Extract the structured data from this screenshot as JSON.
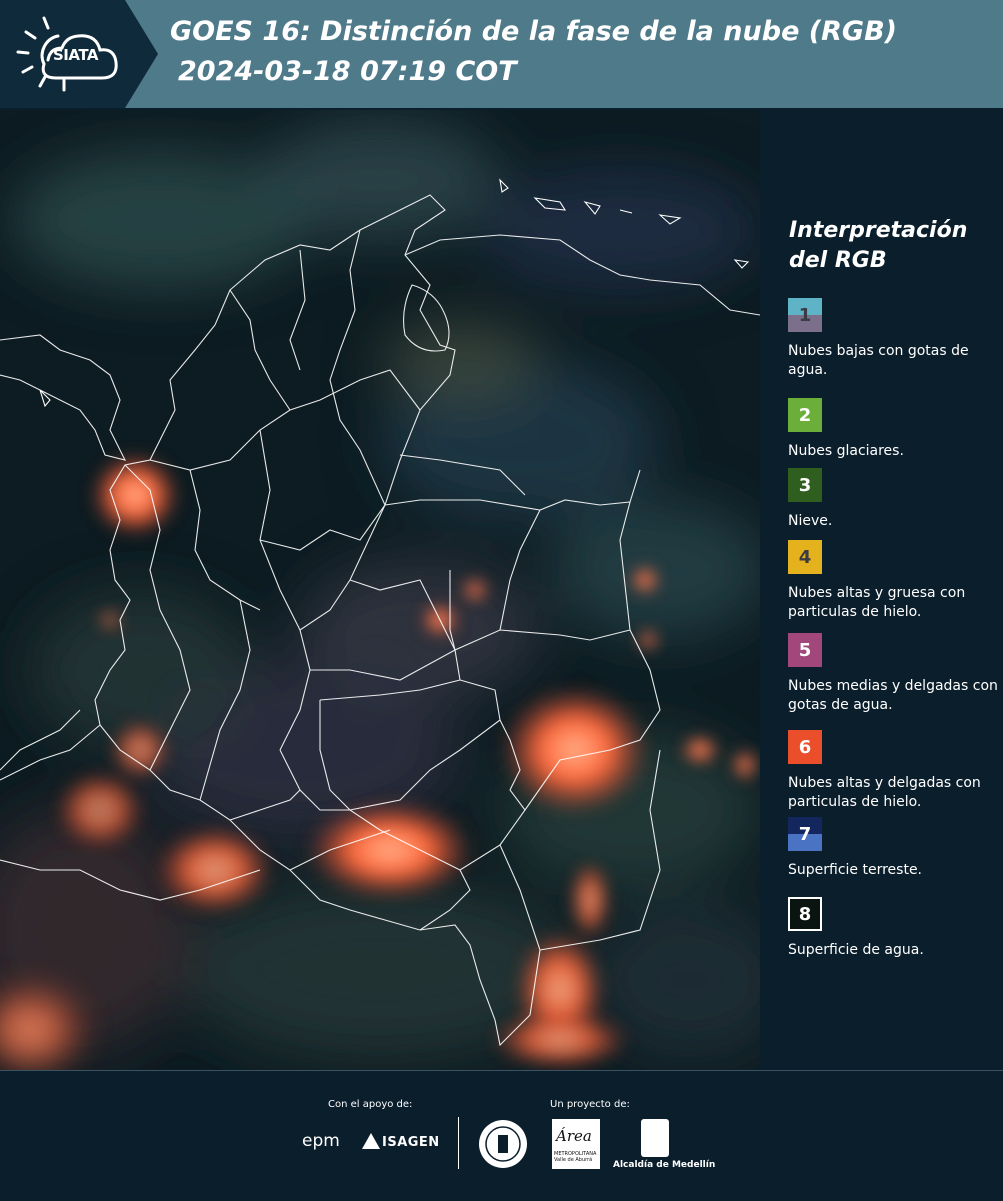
{
  "header": {
    "logo_text": "SIATA",
    "title_line1": "GOES 16: Distinción de la fase de la nube (RGB)",
    "title_line2": "2024-03-18 07:19 COT",
    "logo_icon": "sun-cloud-icon",
    "colors": {
      "bar": "#4e7a89",
      "logo_panel": "#0f2a3a"
    }
  },
  "map": {
    "region": "Colombia",
    "background_color": "#0c1d22",
    "boundary_color": "#ffffff",
    "storm_color": "#ff6a3d"
  },
  "legend": {
    "title_line1": "Interpretación",
    "title_line2": "del RGB",
    "items": [
      {
        "number": "1",
        "label": "Nubes bajas con gotas de agua.",
        "color_top": "#5fb3c6",
        "color_bottom": "#7b6f8c",
        "text_color": "#3b3b44"
      },
      {
        "number": "2",
        "label": "Nubes glaciares.",
        "color_top": "#6cae3a",
        "color_bottom": "#6cae3a",
        "text_color": "#ffffff"
      },
      {
        "number": "3",
        "label": "Nieve.",
        "color_top": "#2f5e1f",
        "color_bottom": "#2f5e1f",
        "text_color": "#ffffff"
      },
      {
        "number": "4",
        "label": "Nubes altas y gruesa con particulas de hielo.",
        "color_top": "#e3b21c",
        "color_bottom": "#e3b21c",
        "text_color": "#3b3b44"
      },
      {
        "number": "5",
        "label": "Nubes medias y delgadas con gotas de agua.",
        "color_top": "#a2477b",
        "color_bottom": "#a2477b",
        "text_color": "#ffffff"
      },
      {
        "number": "6",
        "label": "Nubes altas y delgadas con particulas de hielo.",
        "color_top": "#ea4e2b",
        "color_bottom": "#ea4e2b",
        "text_color": "#ffffff"
      },
      {
        "number": "7",
        "label": "Superficie terreste.",
        "color_top": "#13275e",
        "color_bottom": "#4a73c4",
        "text_color": "#ffffff"
      },
      {
        "number": "8",
        "label": "Superficie de agua.",
        "color_top": "#0a1410",
        "color_bottom": "#0a1410",
        "text_color": "#ffffff",
        "border": "#ffffff"
      }
    ]
  },
  "footer": {
    "support_label": "Con el apoyo de:",
    "project_label": "Un proyecto de:",
    "sponsors": [
      "epm",
      "ISAGEN"
    ],
    "area_word": "Área",
    "area_subtitle": "METROPOLITANA Valle de Aburrá",
    "alcaldia": "Alcaldía de Medellín"
  }
}
